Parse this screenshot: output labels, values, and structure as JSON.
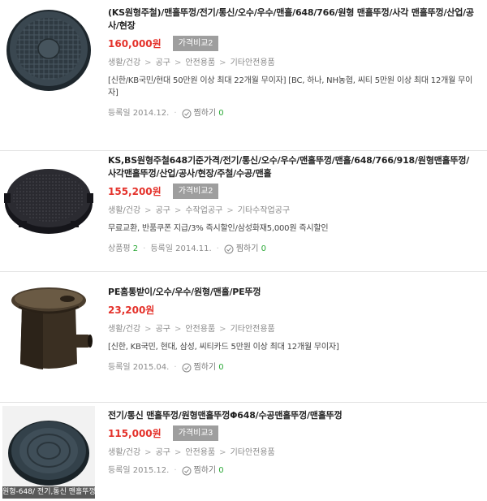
{
  "products": [
    {
      "title": "(KS원형주철)/맨홀뚜껑/전기/통신/오수/우수/맨홀/648/766/원형 맨홀뚜껑/사각 맨홀뚜껑/산업/공사/현장",
      "price": "160,000원",
      "compare": "가격비교2",
      "category": [
        "생활/건강",
        "공구",
        "안전용품",
        "기타안전용품"
      ],
      "promo": "[신한/KB국민/현대 50만원 이상 최대 22개월 무이자] [BC, 하나, NH농협, 씨티 5만원 이상 최대 12개월 무이자]",
      "reviews_label": "",
      "reviews_count": "",
      "reg_date": "등록일 2014.12.",
      "zzim_label": "찜하기",
      "zzim_count": "0",
      "caption": ""
    },
    {
      "title": "KS,BS원형주철648기준가격/전기/통신/오수/우수/맨홀뚜껑/맨홀/648/766/918/원형맨홀뚜껑/사각맨홀뚜껑/산업/공사/현장/주철/수공/맨홀",
      "price": "155,200원",
      "compare": "가격비교2",
      "category": [
        "생활/건강",
        "공구",
        "수작업공구",
        "기타수작업공구"
      ],
      "promo": "무료교환, 반품쿠폰 지급/3% 즉시할인/삼성화재5,000원 즉시할인",
      "reviews_label": "상품평",
      "reviews_count": "2",
      "reg_date": "등록일 2014.11.",
      "zzim_label": "찜하기",
      "zzim_count": "0",
      "caption": ""
    },
    {
      "title": "PE홈통받이/오수/우수/원형/맨홀/PE뚜껑",
      "price": "23,200원",
      "compare": "",
      "category": [
        "생활/건강",
        "공구",
        "안전용품",
        "기타안전용품"
      ],
      "promo": "[신한, KB국민, 현대, 삼성, 씨티카드 5만원 이상 최대 12개월 무이자]",
      "reviews_label": "",
      "reviews_count": "",
      "reg_date": "등록일 2015.04.",
      "zzim_label": "찜하기",
      "zzim_count": "0",
      "caption": ""
    },
    {
      "title": "전기/통신 맨홀뚜껑/원형맨홀뚜껑Φ648/수공맨홀뚜껑/맨홀뚜껑",
      "price": "115,000원",
      "compare": "가격비교3",
      "category": [
        "생활/건강",
        "공구",
        "안전용품",
        "기타안전용품"
      ],
      "promo": "",
      "reviews_label": "",
      "reviews_count": "",
      "reg_date": "등록일 2015.12.",
      "zzim_label": "찜하기",
      "zzim_count": "0",
      "caption": "원형-648/ 전기,통신 맨홀뚜껑"
    }
  ],
  "colors": {
    "price": "#e4322b",
    "compare_bg": "#9e9e9e",
    "count_green": "#2aa836"
  }
}
